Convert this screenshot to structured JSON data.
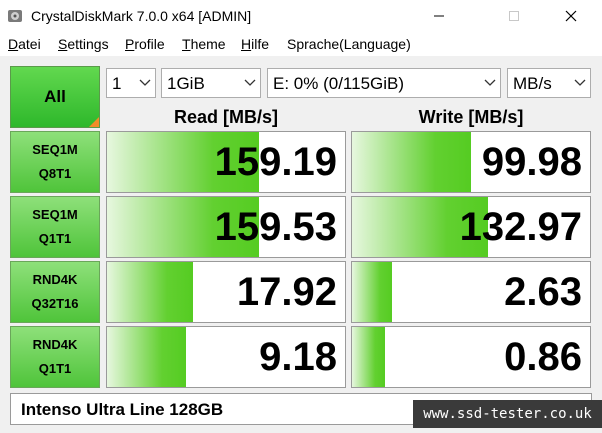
{
  "window": {
    "title": "CrystalDiskMark 7.0.0 x64 [ADMIN]"
  },
  "menu": [
    {
      "label": "Datei",
      "ul": "D",
      "rest": "atei"
    },
    {
      "label": "Settings",
      "ul": "S",
      "rest": "ettings"
    },
    {
      "label": "Profile",
      "ul": "P",
      "rest": "rofile"
    },
    {
      "label": "Theme",
      "ul": "T",
      "rest": "heme"
    },
    {
      "label": "Hilfe",
      "ul": "H",
      "rest": "ilfe"
    },
    {
      "label": "Sprache(Language)",
      "ul": "",
      "rest": "Sprache(Language)"
    }
  ],
  "controls": {
    "all_label": "All",
    "count": "1",
    "size": "1GiB",
    "drive": "E: 0% (0/115GiB)",
    "unit": "MB/s"
  },
  "headers": {
    "read": "Read [MB/s]",
    "write": "Write [MB/s]"
  },
  "rows": [
    {
      "line1": "SEQ1M",
      "line2": "Q8T1",
      "read": "159.19",
      "write": "99.98",
      "read_fill": 0.64,
      "write_fill": 0.5
    },
    {
      "line1": "SEQ1M",
      "line2": "Q1T1",
      "read": "159.53",
      "write": "132.97",
      "read_fill": 0.64,
      "write_fill": 0.57
    },
    {
      "line1": "RND4K",
      "line2": "Q32T16",
      "read": "17.92",
      "write": "2.63",
      "read_fill": 0.36,
      "write_fill": 0.17
    },
    {
      "line1": "RND4K",
      "line2": "Q1T1",
      "read": "9.18",
      "write": "0.86",
      "read_fill": 0.33,
      "write_fill": 0.14
    }
  ],
  "footer": {
    "comment": "Intenso Ultra Line 128GB"
  },
  "watermark": "www.ssd-tester.co.uk",
  "colors": {
    "accent_green": "#55cc22",
    "label_green": "#4fc43a",
    "corner_orange": "#f28c28"
  }
}
